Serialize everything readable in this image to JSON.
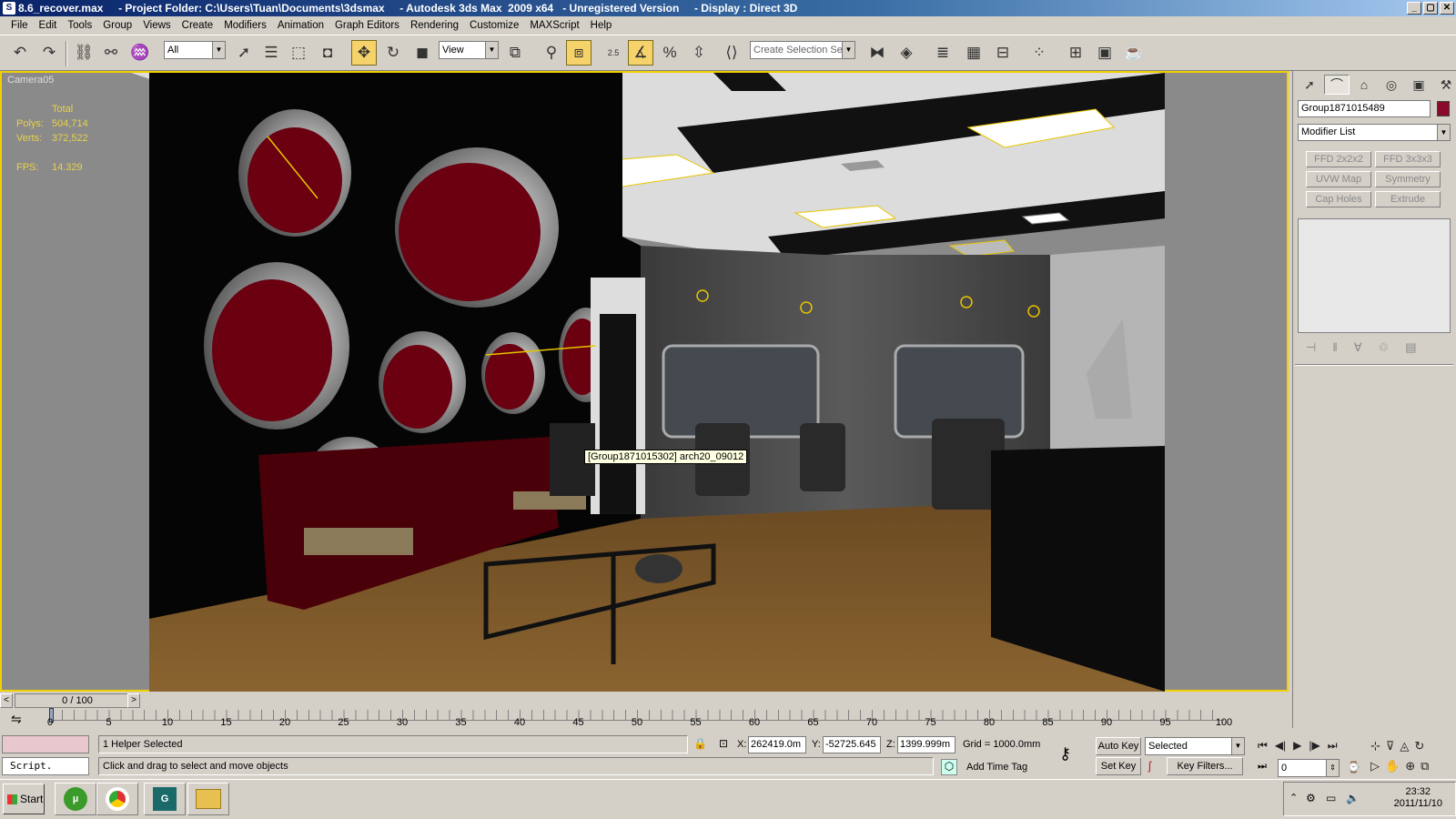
{
  "window": {
    "title": "8.6_recover.max     - Project Folder: C:\\Users\\Tuan\\Documents\\3dsmax     - Autodesk 3ds Max  2009 x64   - Unregistered Version     - Display : Direct 3D",
    "buttons": [
      "_",
      "▢",
      "✕"
    ]
  },
  "menu": [
    "File",
    "Edit",
    "Tools",
    "Group",
    "Views",
    "Create",
    "Modifiers",
    "Animation",
    "Graph Editors",
    "Rendering",
    "Customize",
    "MAXScript",
    "Help"
  ],
  "toolbar": {
    "selection_filter": "All",
    "ref_coord": "View",
    "spinner_label": "2.5",
    "named_selection_placeholder": "Create Selection Set"
  },
  "viewport": {
    "label": "Camera05",
    "stats_header": "Total",
    "polys_label": "Polys:",
    "polys": "504,714",
    "verts_label": "Verts:",
    "verts": "372,522",
    "fps_label": "FPS:",
    "fps": "14.329",
    "tooltip": "[Group1871015302] arch20_09012"
  },
  "command_panel": {
    "object_name": "Group1871015489",
    "object_color": "#8a0a2e",
    "modifier_list": "Modifier List",
    "modifier_buttons": [
      "FFD 2x2x2",
      "FFD 3x3x3",
      "UVW Map",
      "Symmetry",
      "Cap Holes",
      "Extrude"
    ]
  },
  "time_slider": {
    "frame_display": "0 / 100",
    "ticks": [
      "0",
      "5",
      "10",
      "15",
      "20",
      "25",
      "30",
      "35",
      "40",
      "45",
      "50",
      "55",
      "60",
      "65",
      "70",
      "75",
      "80",
      "85",
      "90",
      "95",
      "100"
    ]
  },
  "status": {
    "script_label": "Script.",
    "selection": "1 Helper Selected",
    "prompt": "Click and drag to select and move objects",
    "x_label": "X:",
    "x": "262419.0m",
    "y_label": "Y:",
    "y": "-52725.645",
    "z_label": "Z:",
    "z": "1399.999m",
    "grid": "Grid = 1000.0mm",
    "add_time_tag": "Add Time Tag",
    "auto_key": "Auto Key",
    "set_key": "Set Key",
    "key_mode": "Selected",
    "key_filters": "Key Filters...",
    "current_frame": "0"
  },
  "taskbar": {
    "start": "Start",
    "time": "23:32",
    "date": "2011/11/10"
  }
}
